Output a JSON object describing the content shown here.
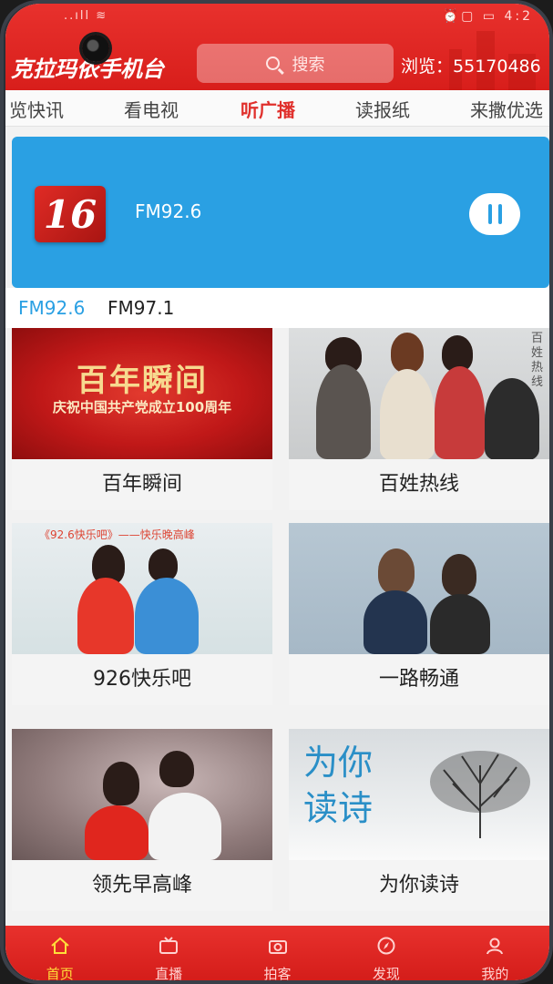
{
  "header": {
    "logo_text": "克拉玛依手机台",
    "search_placeholder": "搜索",
    "views_label": "浏览：",
    "views_count": "55170486",
    "status_left": "..ıll ≋",
    "status_right": "⏰▢ ▭ 4:2"
  },
  "tabs": [
    {
      "label": "览快讯",
      "active": false
    },
    {
      "label": "看电视",
      "active": false
    },
    {
      "label": "听广播",
      "active": true
    },
    {
      "label": "读报纸",
      "active": false
    },
    {
      "label": "来撒优选",
      "active": false
    }
  ],
  "player": {
    "logo_text": "16",
    "station": "FM92.6",
    "state": "playing"
  },
  "frequencies": [
    {
      "label": "FM92.6",
      "active": true
    },
    {
      "label": "FM97.1",
      "active": false
    }
  ],
  "programs": [
    {
      "title": "百年瞬间",
      "thumb_title": "百年瞬间",
      "thumb_subtitle": "庆祝中国共产党成立100周年"
    },
    {
      "title": "百姓热线",
      "thumb_side": "百姓热线"
    },
    {
      "title": "926快乐吧",
      "thumb_header": "《92.6快乐吧》——快乐晚高峰"
    },
    {
      "title": "一路畅通"
    },
    {
      "title": "领先早高峰"
    },
    {
      "title": "为你读诗",
      "thumb_text_1": "为你",
      "thumb_text_2": "读诗"
    }
  ],
  "bottom_nav": [
    {
      "label": "首页",
      "icon": "home-icon",
      "active": true
    },
    {
      "label": "直播",
      "icon": "tv-icon",
      "active": false
    },
    {
      "label": "拍客",
      "icon": "camera-icon",
      "active": false
    },
    {
      "label": "发现",
      "icon": "compass-icon",
      "active": false
    },
    {
      "label": "我的",
      "icon": "user-icon",
      "active": false
    }
  ],
  "colors": {
    "brand_red": "#e0302c",
    "player_blue": "#2aa0e3",
    "nav_active": "#ffdf3a"
  }
}
